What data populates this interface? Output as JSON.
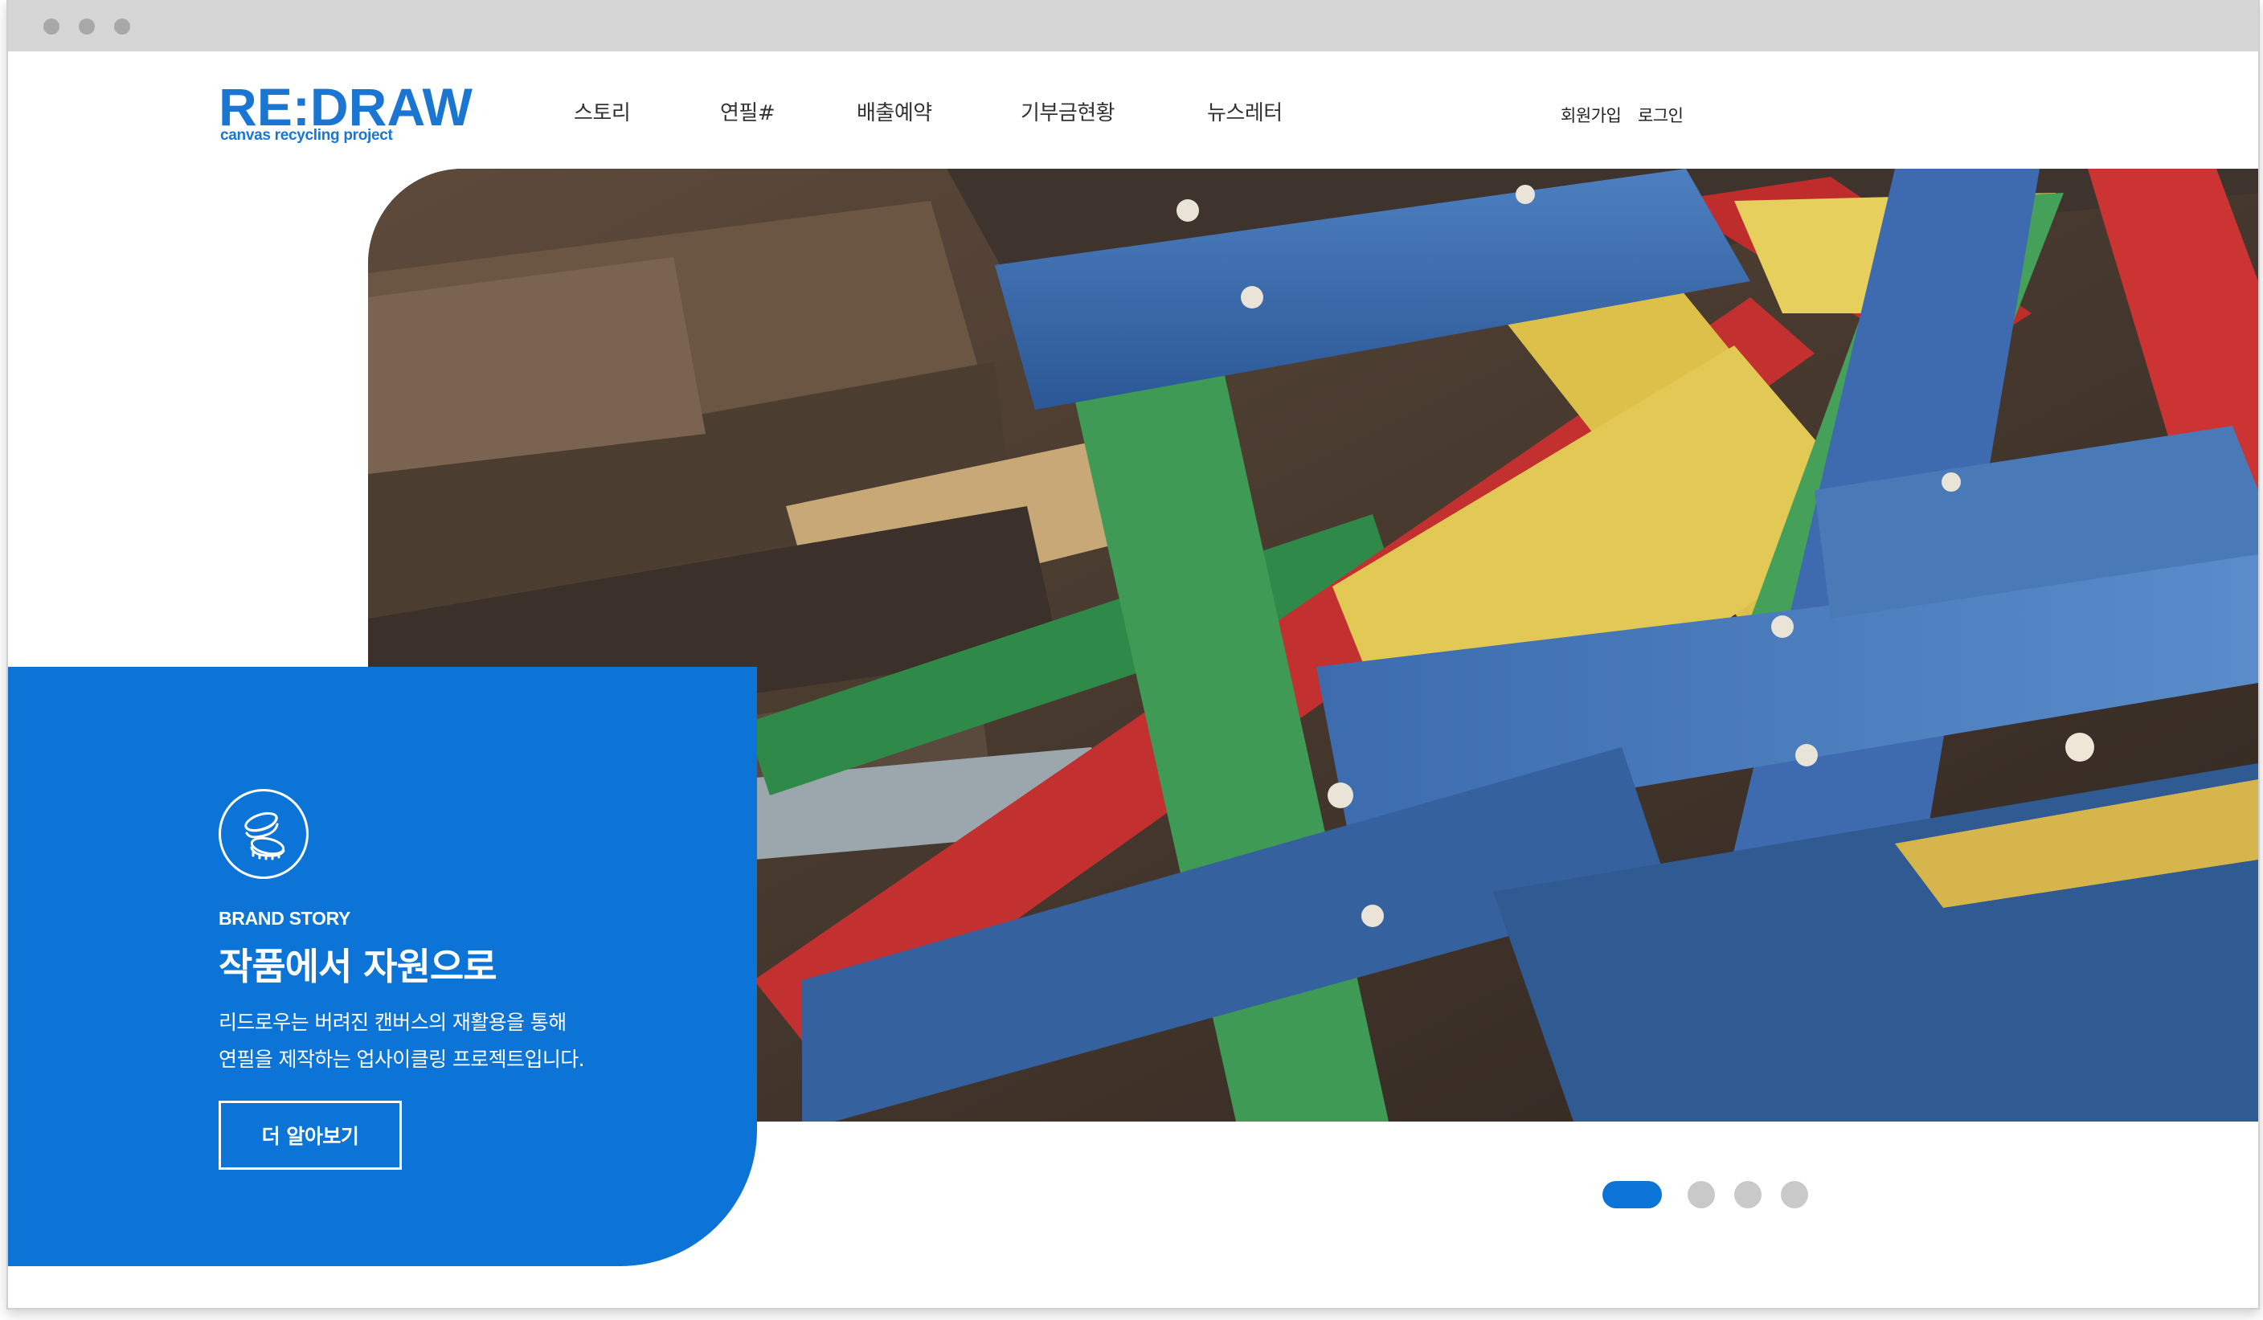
{
  "browser": {
    "window_controls": [
      "close-dot",
      "minimize-dot",
      "maximize-dot"
    ]
  },
  "header": {
    "logo_text": "RE:DRAW",
    "logo_tagline": "canvas recycling project",
    "nav": [
      {
        "label": "스토리"
      },
      {
        "label": "연필#"
      },
      {
        "label": "배출예약"
      },
      {
        "label": "기부금현황"
      },
      {
        "label": "뉴스레터"
      }
    ],
    "signup_label": "회원가입",
    "login_label": "로그인"
  },
  "hero": {
    "image_subject": "stacked painted wooden canvas frames (blue, red, green, yellow)",
    "brand_card": {
      "icon": "coins-icon",
      "eyebrow": "BRAND STORY",
      "headline": "작품에서 자원으로",
      "description_lines": [
        "리드로우는 버려진 캔버스의 재활용을 통해",
        "연필을 제작하는 업사이클링 프로젝트입니다."
      ],
      "cta_label": "더 알아보기"
    },
    "slider": {
      "slide_count": 4,
      "active_index": 0
    }
  },
  "colors": {
    "brand_blue": "#0b74d6",
    "logo_blue": "#1b76d2",
    "pager_inactive": "#c9c9c9",
    "titlebar": "#d6d6d6"
  }
}
